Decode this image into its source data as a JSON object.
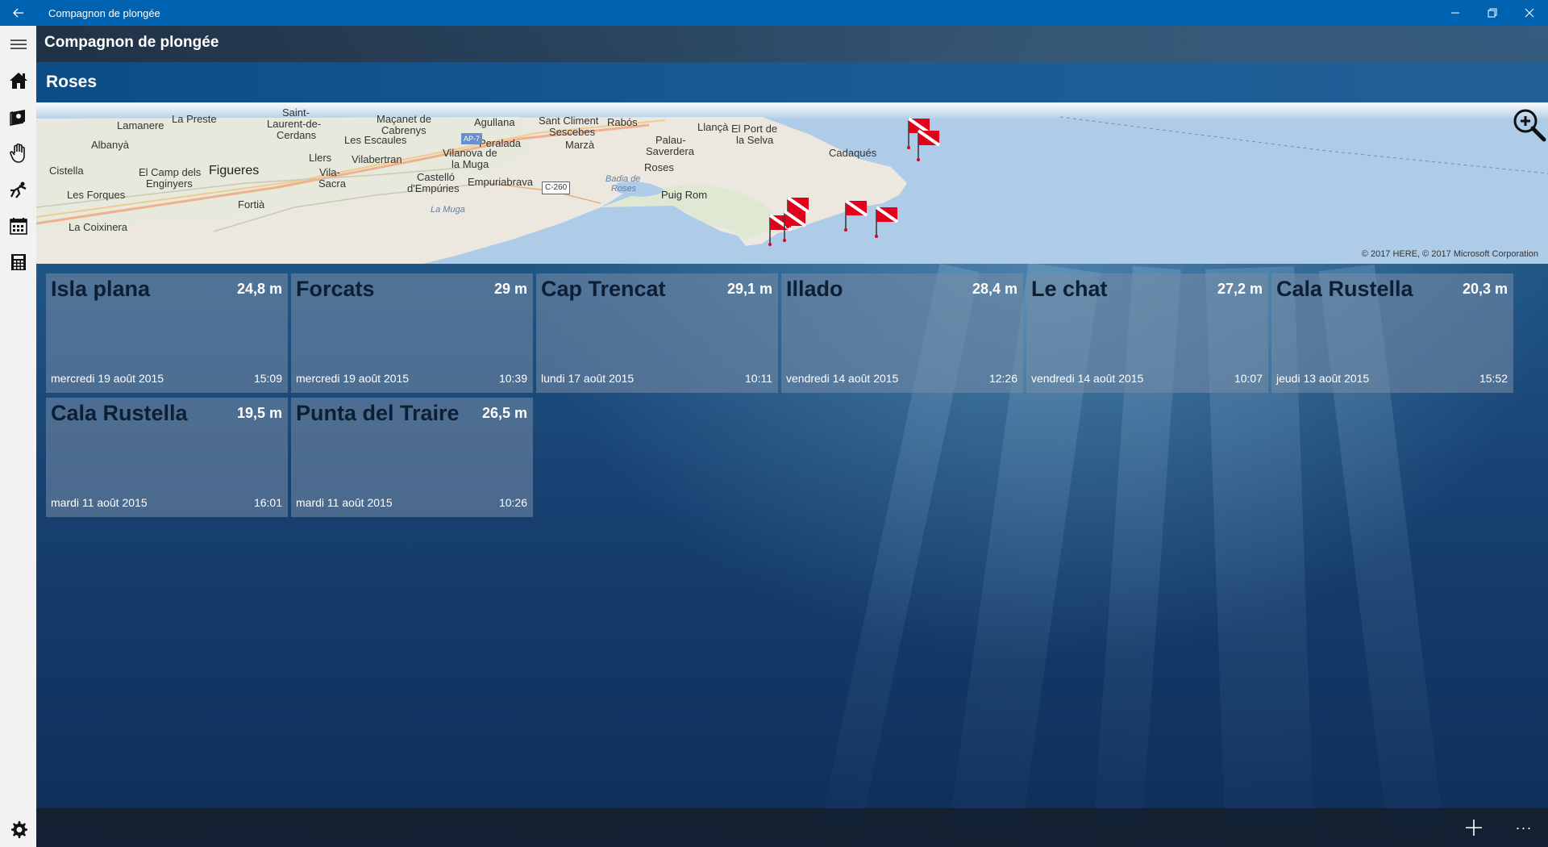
{
  "window": {
    "title": "Compagnon de plongée"
  },
  "app": {
    "title": "Compagnon de plongée",
    "location": "Roses"
  },
  "nav": {
    "icons": [
      "hamburger-icon",
      "home-icon",
      "logbook-icon",
      "hand-sign-icon",
      "diver-icon",
      "calendar-icon",
      "calculator-icon",
      "settings-icon"
    ]
  },
  "map": {
    "copyright": "© 2017 HERE, © 2017 Microsoft Corporation",
    "labels": [
      "Lamanere",
      "La Preste",
      "Saint-",
      "Laurent-de-",
      "Cerdans",
      "Maçanet de",
      "Cabrenys",
      "Agullana",
      "Sant Climent",
      "Sescebes",
      "Rabós",
      "Llançà",
      "El Port de",
      "la Selva",
      "Albanyà",
      "Les Escaules",
      "Peralada",
      "Marzà",
      "Palau-",
      "Saverdera",
      "Cadaqués",
      "Llers",
      "Vilabertran",
      "Vilanova de",
      "la Muga",
      "Cistella",
      "Vila-",
      "Sacra",
      "El Camp dels",
      "Enginyers",
      "Figueres",
      "Castelló",
      "d'Empúries",
      "Empuriabrava",
      "Roses",
      "Les Forques",
      "Puig Rom",
      "Fortià",
      "La Coixinera",
      "La Muga",
      "Badia de",
      "Roses",
      "AP-7",
      "C-260"
    ]
  },
  "dives": [
    {
      "name": "Isla plana",
      "depth": "24,8 m",
      "date": "mercredi 19 août 2015",
      "time": "15:09"
    },
    {
      "name": "Forcats",
      "depth": "29 m",
      "date": "mercredi 19 août 2015",
      "time": "10:39"
    },
    {
      "name": "Cap Trencat",
      "depth": "29,1 m",
      "date": "lundi 17 août 2015",
      "time": "10:11"
    },
    {
      "name": "Illado",
      "depth": "28,4 m",
      "date": "vendredi 14 août 2015",
      "time": "12:26"
    },
    {
      "name": "Le chat",
      "depth": "27,2 m",
      "date": "vendredi 14 août 2015",
      "time": "10:07"
    },
    {
      "name": "Cala Rustella",
      "depth": "20,3 m",
      "date": "jeudi 13 août 2015",
      "time": "15:52"
    },
    {
      "name": "Cala Rustella",
      "depth": "19,5 m",
      "date": "mardi 11 août 2015",
      "time": "16:01"
    },
    {
      "name": "Punta del Traire",
      "depth": "26,5 m",
      "date": "mardi 11 août 2015",
      "time": "10:26"
    }
  ],
  "bottombar": {
    "more": "···"
  },
  "colors": {
    "titlebar": "#0063b1",
    "flag_red": "#e3001b"
  }
}
